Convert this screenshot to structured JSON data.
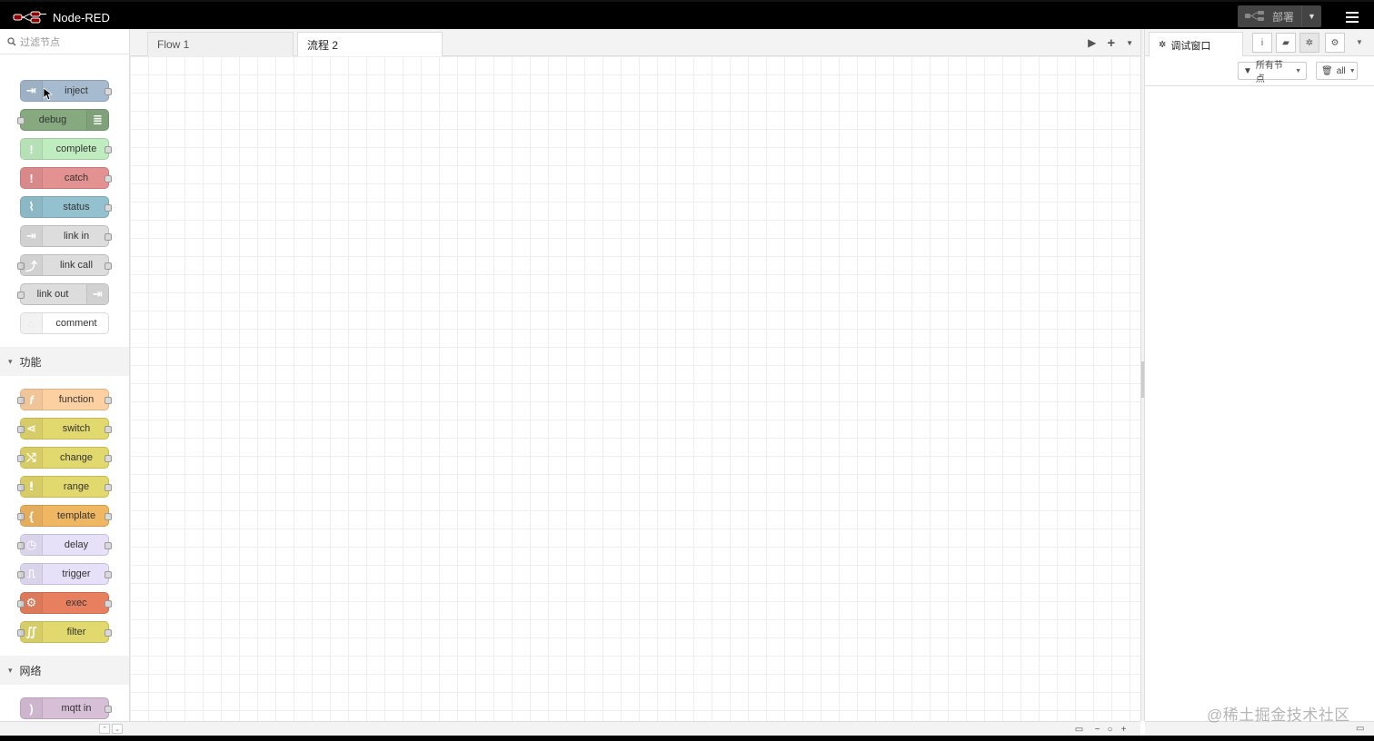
{
  "app": {
    "title": "Node-RED"
  },
  "header": {
    "deploy_label": "部署"
  },
  "palette": {
    "search_placeholder": "过滤节点",
    "categories": [
      {
        "label": "功能"
      },
      {
        "label": "网络"
      }
    ],
    "nodes_common": [
      {
        "label": "inject",
        "color": "#a6bbcf"
      },
      {
        "label": "debug",
        "color": "#87a980"
      },
      {
        "label": "complete",
        "color": "#c0edc0"
      },
      {
        "label": "catch",
        "color": "#e49191"
      },
      {
        "label": "status",
        "color": "#94c1d0"
      },
      {
        "label": "link in",
        "color": "#dddddd"
      },
      {
        "label": "link call",
        "color": "#dddddd"
      },
      {
        "label": "link out",
        "color": "#dddddd"
      },
      {
        "label": "comment",
        "color": "#ffffff"
      }
    ],
    "nodes_function": [
      {
        "label": "function",
        "color": "#fdd0a2"
      },
      {
        "label": "switch",
        "color": "#e2d96e"
      },
      {
        "label": "change",
        "color": "#e2d96e"
      },
      {
        "label": "range",
        "color": "#e2d96e"
      },
      {
        "label": "template",
        "color": "#f0b763"
      },
      {
        "label": "delay",
        "color": "#e6e0f8"
      },
      {
        "label": "trigger",
        "color": "#e6e0f8"
      },
      {
        "label": "exec",
        "color": "#e8805f"
      },
      {
        "label": "filter",
        "color": "#e2d96e"
      }
    ],
    "nodes_network": [
      {
        "label": "mqtt in",
        "color": "#d8bfd8"
      }
    ]
  },
  "workspace": {
    "tabs": [
      {
        "label": "Flow 1"
      },
      {
        "label": "流程 2"
      }
    ]
  },
  "sidebar": {
    "active_tab_label": "调试窗口",
    "filter_nodes_label": "所有节点",
    "clear_label": "all"
  },
  "watermark": "@稀土掘金技术社区"
}
